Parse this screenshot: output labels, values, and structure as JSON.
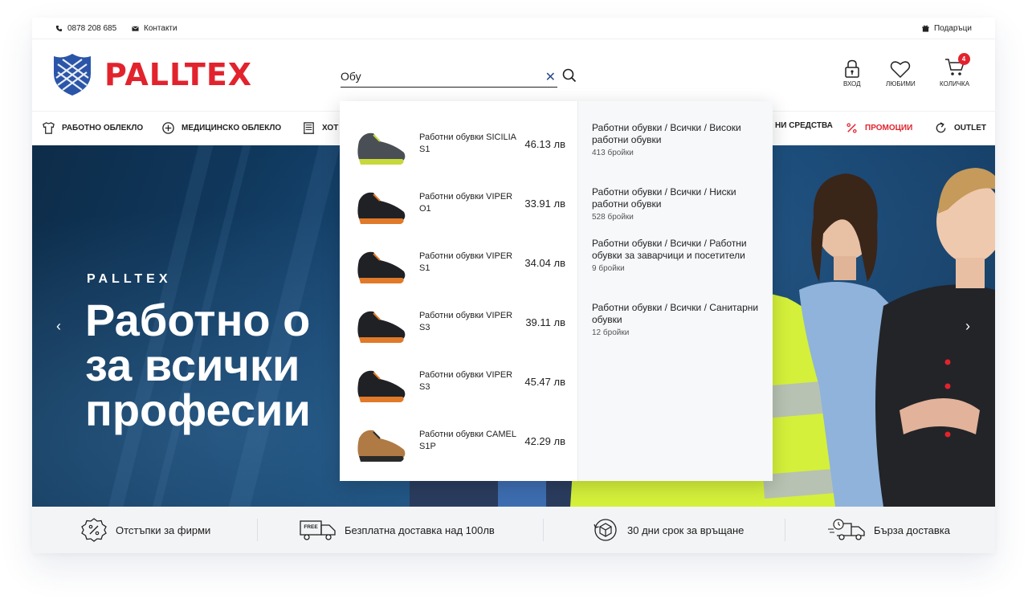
{
  "topbar": {
    "phone": "0878 208 685",
    "contacts": "Контакти",
    "gifts": "Подаръци"
  },
  "brand": {
    "name": "PALLTEX",
    "color": "#e2232d",
    "shield_color": "#2b55a8"
  },
  "search": {
    "value": "Обу",
    "clear_icon": "close-icon",
    "submit_icon": "search-icon"
  },
  "header_actions": {
    "login": "ВХОД",
    "favorites": "ЛЮБИМИ",
    "cart": "КОЛИЧКА",
    "cart_count": "4"
  },
  "nav": {
    "items": [
      {
        "label": "РАБОТНО ОБЛЕКЛО",
        "icon": "shirt-icon"
      },
      {
        "label": "МЕДИЦИНСКО ОБЛЕКЛО",
        "icon": "medical-cross-icon"
      },
      {
        "label": "ХОТ",
        "icon": "hotel-icon"
      },
      {
        "label": "НИ СРЕДСТВА",
        "icon": ""
      },
      {
        "label": "ПРОМОЦИИ",
        "icon": "percent-icon"
      },
      {
        "label": "OUTLET",
        "icon": "refresh-icon"
      }
    ]
  },
  "hero": {
    "kicker": "PALLTEX",
    "title": "Работно о\nза всички\nпрофесии"
  },
  "dropdown": {
    "products": [
      {
        "name": "Работни обувки SICILIA S1",
        "price": "46.13 лв",
        "shoe": "gray"
      },
      {
        "name": "Работни обувки VIPER O1",
        "price": "33.91 лв",
        "shoe": "black"
      },
      {
        "name": "Работни обувки VIPER S1",
        "price": "34.04 лв",
        "shoe": "black"
      },
      {
        "name": "Работни обувки VIPER S3",
        "price": "39.11 лв",
        "shoe": "black"
      },
      {
        "name": "Работни обувки VIPER S3",
        "price": "45.47 лв",
        "shoe": "black"
      },
      {
        "name": "Работни обувки CAMEL S1P",
        "price": "42.29 лв",
        "shoe": "brown"
      }
    ],
    "categories": [
      {
        "path": "Работни обувки / Всички / Високи работни обувки",
        "count": "413 бройки"
      },
      {
        "path": "Работни обувки / Всички / Ниски работни обувки",
        "count": "528 бройки"
      },
      {
        "path": "Работни обувки / Всички / Работни обувки за заварчици и посетители",
        "count": "9 бройки"
      },
      {
        "path": "Работни обувки / Всички / Санитарни обувки",
        "count": "12 бройки"
      }
    ]
  },
  "features": [
    {
      "label": "Отстъпки за фирми",
      "icon": "discount-badge-icon"
    },
    {
      "label": "Безплатна доставка над 100лв",
      "icon": "free-delivery-truck-icon",
      "icon_text": "FREE"
    },
    {
      "label": "30 дни срок за връщане",
      "icon": "return-box-icon"
    },
    {
      "label": "Бърза доставка",
      "icon": "fast-delivery-icon"
    }
  ]
}
